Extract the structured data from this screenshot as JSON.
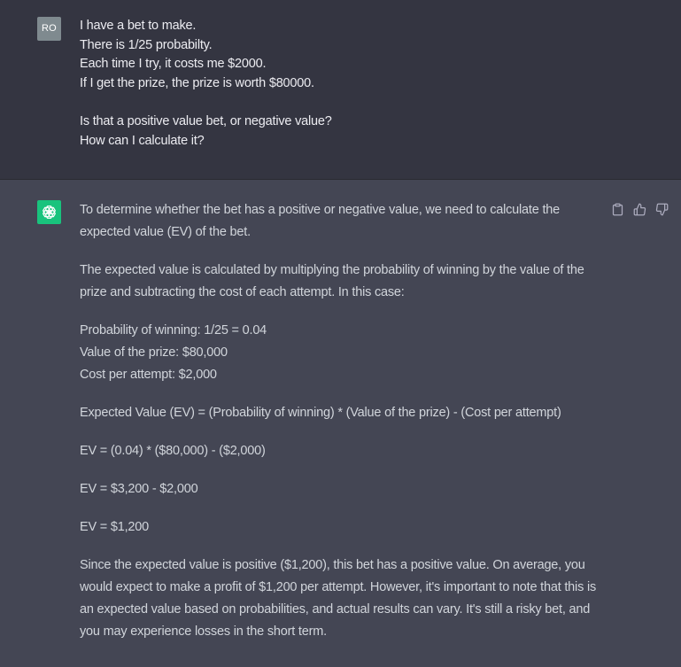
{
  "user": {
    "avatar_initials": "RO",
    "lines": [
      "I have a bet to make.",
      "There is 1/25 probabilty.",
      "Each time I try, it costs me $2000.",
      "If I get the prize, the prize is worth $80000.",
      "",
      "Is that a positive value bet, or negative value?",
      "How can I calculate it?"
    ]
  },
  "assistant": {
    "avatar_icon": "openai-logo-icon",
    "paragraphs": {
      "p1": "To determine whether the bet has a positive or negative value, we need to calculate the expected value (EV) of the bet.",
      "p2": "The expected value is calculated by multiplying the probability of winning by the value of the prize and subtracting the cost of each attempt. In this case:",
      "values": {
        "probability": "Probability of winning: 1/25 = 0.04",
        "prize": "Value of the prize: $80,000",
        "cost": "Cost per attempt: $2,000"
      },
      "formula": "Expected Value (EV) = (Probability of winning) * (Value of the prize) - (Cost per attempt)",
      "step1": "EV = (0.04) * ($80,000) - ($2,000)",
      "step2": "EV = $3,200 - $2,000",
      "step3": "EV = $1,200",
      "conclusion": "Since the expected value is positive ($1,200), this bet has a positive value. On average, you would expect to make a profit of $1,200 per attempt. However, it's important to note that this is an expected value based on probabilities, and actual results can vary. It's still a risky bet, and you may experience losses in the short term."
    },
    "actions": [
      "copy-icon",
      "thumbs-up-icon",
      "thumbs-down-icon"
    ]
  },
  "colors": {
    "user_bg": "#343541",
    "assistant_bg": "#444654",
    "bot_avatar": "#19c37d",
    "user_avatar": "#7f8a8f"
  }
}
